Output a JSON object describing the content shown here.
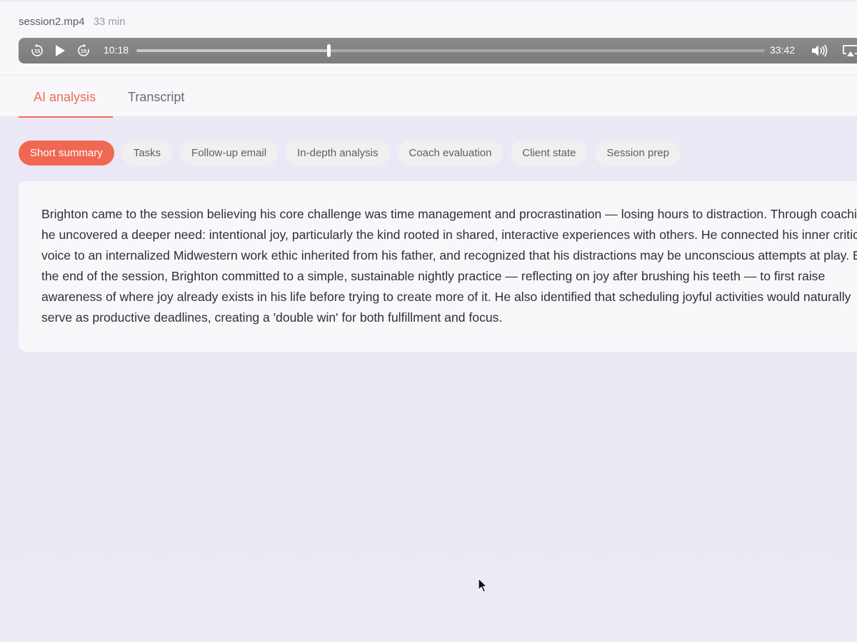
{
  "file": {
    "name": "session2.mp4",
    "duration": "33 min"
  },
  "player": {
    "current_time": "10:18",
    "total_time": "33:42",
    "progress_fraction": 0.3056,
    "icons": [
      "rewind-15-icon",
      "play-icon",
      "forward-15-icon",
      "volume-icon",
      "airplay-icon"
    ],
    "skip_label": "15"
  },
  "tabs": [
    {
      "label": "AI analysis",
      "active": true
    },
    {
      "label": "Transcript",
      "active": false
    }
  ],
  "pills": [
    {
      "label": "Short summary",
      "active": true
    },
    {
      "label": "Tasks",
      "active": false
    },
    {
      "label": "Follow-up email",
      "active": false
    },
    {
      "label": "In-depth analysis",
      "active": false
    },
    {
      "label": "Coach evaluation",
      "active": false
    },
    {
      "label": "Client state",
      "active": false
    },
    {
      "label": "Session prep",
      "active": false
    }
  ],
  "summary": {
    "text": "Brighton came to the session believing his core challenge was time management and procrastination — losing hours to distraction. Through coaching, he uncovered a deeper need: intentional joy, particularly the kind rooted in shared, interactive experiences with others. He connected his inner critical voice to an internalized Midwestern work ethic inherited from his father, and recognized that his distractions may be unconscious attempts at play. By the end of the session, Brighton committed to a simple, sustainable nightly practice — reflecting on joy after brushing his teeth — to first raise awareness of where joy already exists in his life before trying to create more of it. He also identified that scheduling joyful activities would naturally serve as productive deadlines, creating a 'double win' for both fulfillment and focus."
  },
  "colors": {
    "accent": "#f06852",
    "tab_active": "#ef6b55",
    "background": "#ece9f6"
  }
}
